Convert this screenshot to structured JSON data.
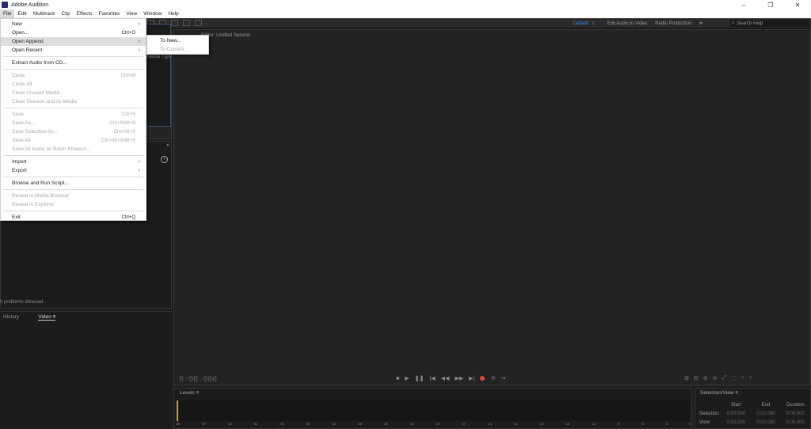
{
  "window": {
    "title": "Adobe Audition",
    "min": "–",
    "restore": "❐",
    "close": "✕"
  },
  "menubar": [
    "File",
    "Edit",
    "Multitrack",
    "Clip",
    "Effects",
    "Favorites",
    "View",
    "Window",
    "Help"
  ],
  "workspaces": {
    "default": "Default",
    "default_menu": "≡",
    "edit_video": "Edit Audio to Video",
    "radio": "Radio Production",
    "more": "»"
  },
  "search": {
    "placeholder": "Search Help"
  },
  "file_menu": {
    "new": "New",
    "open": "Open...",
    "open_sc": "Ctrl+O",
    "open_append": "Open Append",
    "open_recent": "Open Recent",
    "extract": "Extract Audio from CD...",
    "close": "Close",
    "close_sc": "Ctrl+W",
    "close_all": "Close All",
    "close_unused": "Close Unused Media",
    "close_session": "Close Session and its Media",
    "save": "Save",
    "save_sc": "Ctrl+S",
    "save_as": "Save As...",
    "save_as_sc": "Ctrl+Shift+S",
    "save_sel": "Save Selection As...",
    "save_sel_sc": "Ctrl+Alt+S",
    "save_all": "Save All",
    "save_all_sc": "Ctrl+Alt+Shift+S",
    "save_batch": "Save All Audio as Batch Process...",
    "import": "Import",
    "export": "Export",
    "browse_script": "Browse and Run Script...",
    "reveal_media": "Reveal in Media Browser",
    "reveal_explorer": "Reveal in Explorer",
    "exit": "Exit",
    "exit_sc": "Ctrl+Q"
  },
  "submenu": {
    "to_new": "To New...",
    "to_current": "To Current..."
  },
  "panels": {
    "media_type": "Media Type",
    "editor_title": "Editor: Untitled Session",
    "problems": "0 problems detected.",
    "history_tab": "History",
    "video_tab": "Video",
    "tab_menu": "≡",
    "time": "0:00.000",
    "levels": "Levels",
    "selection_view": "Selection/View"
  },
  "levels_scale": [
    "dB",
    "-57",
    "-54",
    "-51",
    "-48",
    "-45",
    "-42",
    "-39",
    "-36",
    "-33",
    "-30",
    "-27",
    "-24",
    "-21",
    "-18",
    "-15",
    "-12",
    "-9",
    "-6",
    "-3",
    "0"
  ],
  "selview": {
    "start": "Start",
    "end": "End",
    "duration": "Duration",
    "selection": "Selection",
    "view": "View",
    "zero": "0:00.000"
  },
  "colors": {
    "accent": "#3f8de0",
    "record": "#e0453a",
    "level": "#c7a51a"
  }
}
